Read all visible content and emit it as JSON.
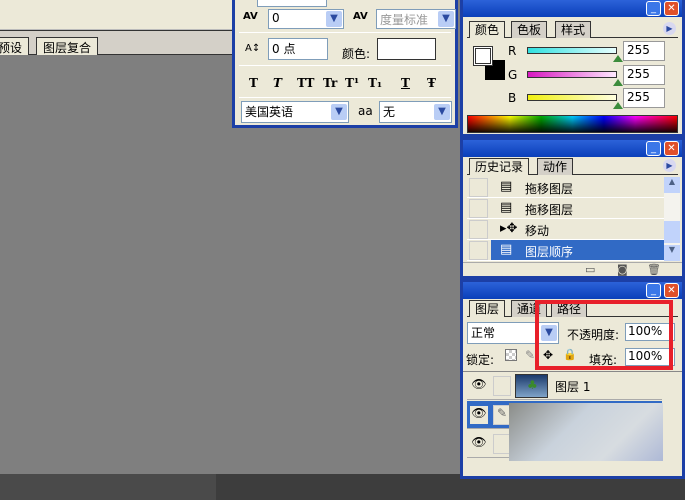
{
  "doc_tabs": {
    "presets": "预设",
    "layer_comps": "图层复合"
  },
  "character": {
    "kerning_value": "0",
    "tracking_value": "度量标准",
    "baseline_value": "0 点",
    "color_label": "颜色:",
    "style_buttons": [
      "T",
      "T",
      "TT",
      "Tr",
      "T¹",
      "T₁",
      "T",
      "Ŧ"
    ],
    "language": "美国英语",
    "aa_label": "aa",
    "antialias": "无"
  },
  "color_panel": {
    "tabs": [
      "颜色",
      "色板",
      "样式"
    ],
    "channels": [
      {
        "label": "R",
        "value": "255",
        "color": "#40e0e0"
      },
      {
        "label": "G",
        "value": "255",
        "color": "#e020c0"
      },
      {
        "label": "B",
        "value": "255",
        "color": "#f0f020"
      }
    ]
  },
  "history_panel": {
    "tabs": [
      "历史记录",
      "动作"
    ],
    "items": [
      {
        "label": "拖移图层",
        "selected": false
      },
      {
        "label": "拖移图层",
        "selected": false
      },
      {
        "label": "移动",
        "selected": false
      },
      {
        "label": "图层顺序",
        "selected": true
      }
    ]
  },
  "layers_panel": {
    "tabs": [
      "图层",
      "通道",
      "路径"
    ],
    "blend_mode": "正常",
    "opacity_label": "不透明度:",
    "opacity_value": "100%",
    "lock_label": "锁定:",
    "fill_label": "填充:",
    "fill_value": "100%",
    "layers": [
      {
        "name": "图层 1"
      },
      {
        "name": ""
      },
      {
        "name": ""
      }
    ]
  },
  "highlight_color": "#e8202a"
}
